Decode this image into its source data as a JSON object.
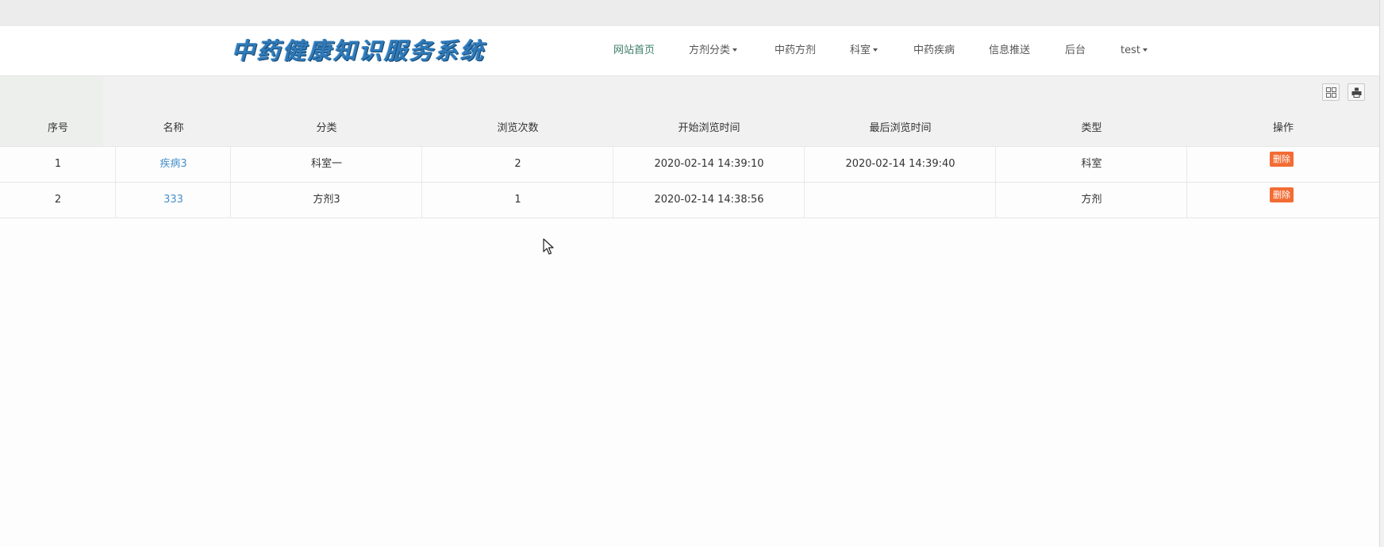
{
  "site": {
    "logo_text": "中药健康知识服务系统"
  },
  "nav": {
    "items": [
      {
        "label": "网站首页",
        "dropdown": false,
        "active": true
      },
      {
        "label": "方剂分类",
        "dropdown": true,
        "active": false
      },
      {
        "label": "中药方剂",
        "dropdown": false,
        "active": false
      },
      {
        "label": "科室",
        "dropdown": true,
        "active": false
      },
      {
        "label": "中药疾病",
        "dropdown": false,
        "active": false
      },
      {
        "label": "信息推送",
        "dropdown": false,
        "active": false
      },
      {
        "label": "后台",
        "dropdown": false,
        "active": false
      },
      {
        "label": "test",
        "dropdown": true,
        "active": false
      }
    ]
  },
  "toolbar": {
    "columns_icon": "columns-icon",
    "print_icon": "print-icon"
  },
  "table": {
    "headers": [
      "序号",
      "名称",
      "分类",
      "浏览次数",
      "开始浏览时间",
      "最后浏览时间",
      "类型",
      "操作"
    ],
    "rows": [
      {
        "index": "1",
        "name": "疾病3",
        "category": "科室一",
        "views": "2",
        "start_time": "2020-02-14 14:39:10",
        "last_time": "2020-02-14 14:39:40",
        "type": "科室",
        "action": "删除"
      },
      {
        "index": "2",
        "name": "333",
        "category": "方剂3",
        "views": "1",
        "start_time": "2020-02-14 14:38:56",
        "last_time": "",
        "type": "方剂",
        "action": "删除"
      }
    ]
  },
  "colors": {
    "link": "#4a8fc9",
    "active_nav": "#3c7d6a",
    "delete_button": "#f26c34",
    "logo": "#2f79b8"
  }
}
